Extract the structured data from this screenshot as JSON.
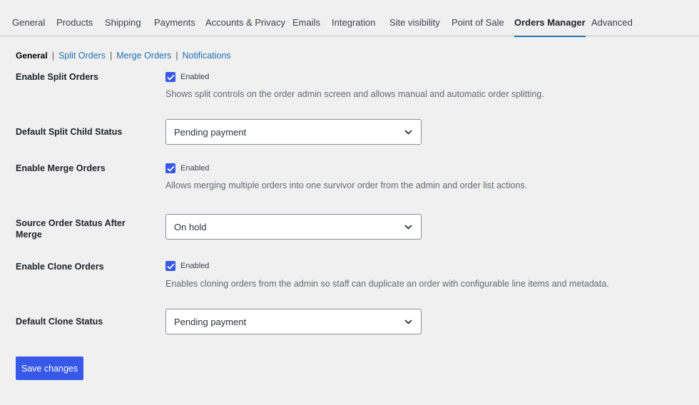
{
  "tabs": [
    {
      "label": "General"
    },
    {
      "label": "Products"
    },
    {
      "label": "Shipping"
    },
    {
      "label": "Payments"
    },
    {
      "label": "Accounts & Privacy"
    },
    {
      "label": "Emails"
    },
    {
      "label": "Integration"
    },
    {
      "label": "Site visibility"
    },
    {
      "label": "Point of Sale"
    },
    {
      "label": "Orders Manager",
      "active": true
    },
    {
      "label": "Advanced"
    }
  ],
  "subnav": {
    "current": "General",
    "separator": "|",
    "links": [
      "Split Orders",
      "Merge Orders",
      "Notifications"
    ]
  },
  "settings": {
    "enable_split": {
      "label": "Enable Split Orders",
      "checkbox_label": "Enabled",
      "checked": true,
      "description": "Shows split controls on the order admin screen and allows manual and automatic order splitting."
    },
    "split_child_status": {
      "label": "Default Split Child Status",
      "value": "Pending payment"
    },
    "enable_merge": {
      "label": "Enable Merge Orders",
      "checkbox_label": "Enabled",
      "checked": true,
      "description": "Allows merging multiple orders into one survivor order from the admin and order list actions."
    },
    "source_status_after_merge": {
      "label": "Source Order Status After Merge",
      "value": "On hold"
    },
    "enable_clone": {
      "label": "Enable Clone Orders",
      "checkbox_label": "Enabled",
      "checked": true,
      "description": "Enables cloning orders from the admin so staff can duplicate an order with configurable line items and metadata."
    },
    "clone_status": {
      "label": "Default Clone Status",
      "value": "Pending payment"
    }
  },
  "save_label": "Save changes",
  "colors": {
    "accent": "#3858e9",
    "link": "#2271b1",
    "background": "#f0f0f1"
  },
  "icons": {
    "checkbox": "checkmark-icon",
    "select": "chevron-down-icon"
  }
}
